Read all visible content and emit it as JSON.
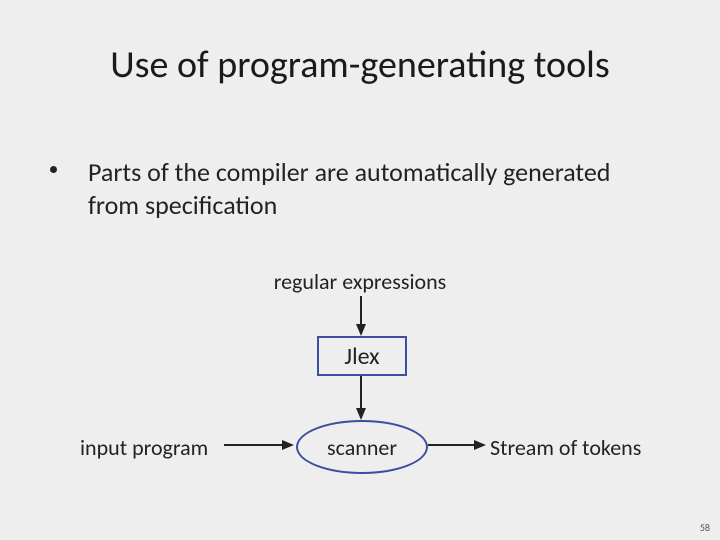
{
  "slide": {
    "title": "Use of program-generating tools",
    "bullet": "Parts of the compiler are automatically generated from specification",
    "labels": {
      "regexp": "regular expressions",
      "jlex": "Jlex",
      "scanner": "scanner",
      "input_program": "input program",
      "stream_of_tokens": "Stream of tokens"
    },
    "page_number": "58"
  }
}
